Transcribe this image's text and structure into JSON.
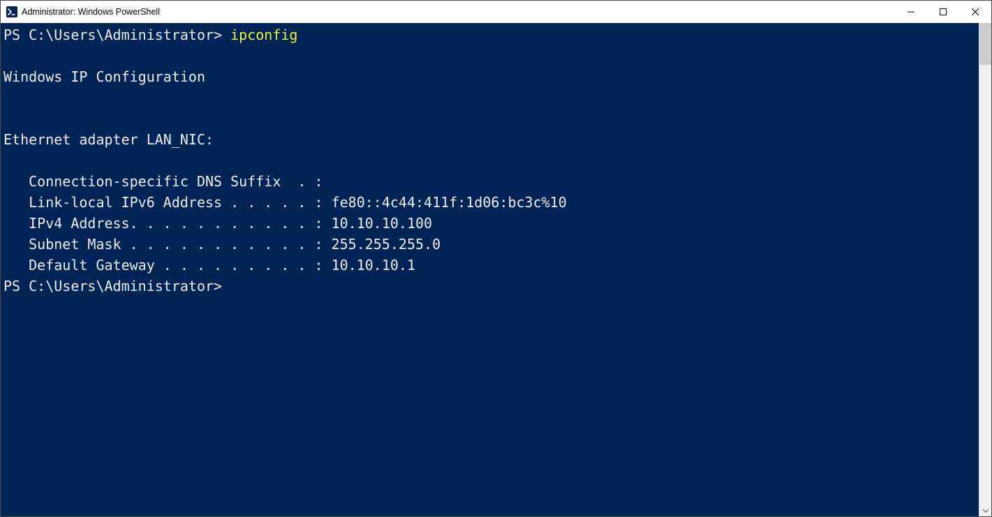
{
  "window": {
    "title": "Administrator: Windows PowerShell"
  },
  "terminal": {
    "prompt1": "PS C:\\Users\\Administrator> ",
    "command": "ipconfig",
    "blank1": "",
    "header": "Windows IP Configuration",
    "blank2": "",
    "blank3": "",
    "adapter": "Ethernet adapter LAN_NIC:",
    "blank4": "",
    "dns": "   Connection-specific DNS Suffix  . :",
    "ipv6": "   Link-local IPv6 Address . . . . . : fe80::4c44:411f:1d06:bc3c%10",
    "ipv4": "   IPv4 Address. . . . . . . . . . . : 10.10.10.100",
    "mask": "   Subnet Mask . . . . . . . . . . . : 255.255.255.0",
    "gw": "   Default Gateway . . . . . . . . . : 10.10.10.1",
    "prompt2": "PS C:\\Users\\Administrator>"
  }
}
